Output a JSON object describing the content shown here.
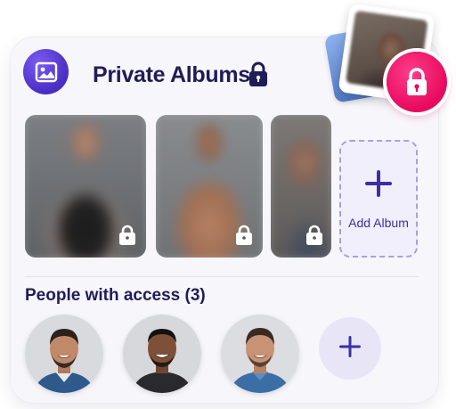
{
  "header": {
    "title": "Private Albums",
    "icon": "image-icon",
    "title_icon": "lock-icon"
  },
  "albums": [
    {
      "name": "album-photo-1",
      "locked": true
    },
    {
      "name": "album-photo-2",
      "locked": true
    },
    {
      "name": "album-photo-3",
      "locked": true
    }
  ],
  "add_album": {
    "label": "Add Album",
    "icon": "plus-icon"
  },
  "access": {
    "title": "People with access (3)",
    "people": [
      {
        "name": "person-1",
        "shirt_color": "#2d5a8a"
      },
      {
        "name": "person-2",
        "shirt_color": "#2a2a2e"
      },
      {
        "name": "person-3",
        "shirt_color": "#3b6ea5"
      }
    ],
    "add_icon": "plus-icon"
  },
  "colors": {
    "accent": "#4a2cc4",
    "title_text": "#201c57",
    "lock_badge": "#e7095e",
    "add_border": "#a8a0e0"
  }
}
